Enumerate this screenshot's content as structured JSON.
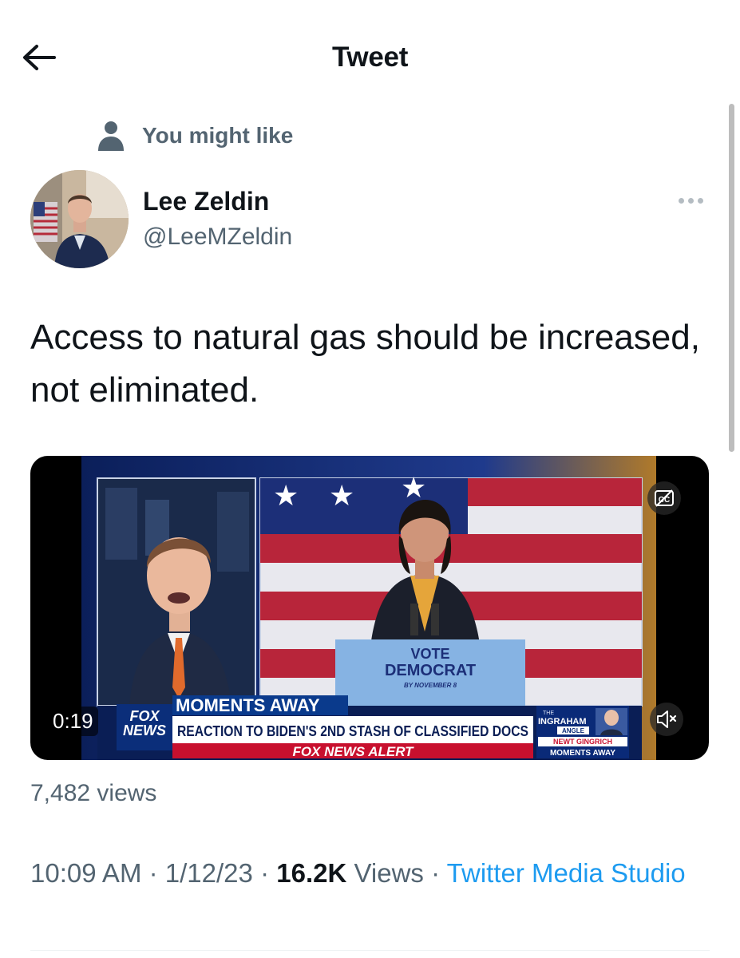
{
  "header": {
    "title": "Tweet",
    "back_icon": "arrow-left-icon"
  },
  "context": {
    "icon": "person-icon",
    "label": "You might like"
  },
  "author": {
    "display_name": "Lee Zeldin",
    "handle": "@LeeMZeldin"
  },
  "tweet": {
    "text": "Access to natural gas should be increased, not eliminated."
  },
  "media": {
    "duration": "0:19",
    "video": {
      "moments_banner": "MOMENTS AWAY",
      "headline": "REACTION TO BIDEN'S 2ND STASH OF CLASSIFIED DOCS",
      "alert": "FOX NEWS ALERT",
      "network_top": "FOX",
      "network_bottom": "NEWS",
      "podium_line1": "VOTE",
      "podium_line2": "DEMOCRAT",
      "podium_line3": "BY NOVEMBER 8",
      "show_small": "THE",
      "show_name": "INGRAHAM",
      "show_sub": "ANGLE",
      "promo_name": "NEWT GINGRICH",
      "promo_sub": "MOMENTS AWAY"
    },
    "cc_icon": "closed-captions-icon",
    "mute_icon": "speaker-muted-icon"
  },
  "stats": {
    "video_views": "7,482 views"
  },
  "meta": {
    "time": "10:09 AM",
    "date": "1/12/23",
    "views_count": "16.2K",
    "views_word": "Views",
    "source": "Twitter Media Studio",
    "separator": "·"
  },
  "colors": {
    "link": "#1d9bf0",
    "secondary_text": "#536471",
    "primary_text": "#0f1419",
    "fox_blue": "#0a3a8c",
    "fox_red": "#c8102e"
  }
}
